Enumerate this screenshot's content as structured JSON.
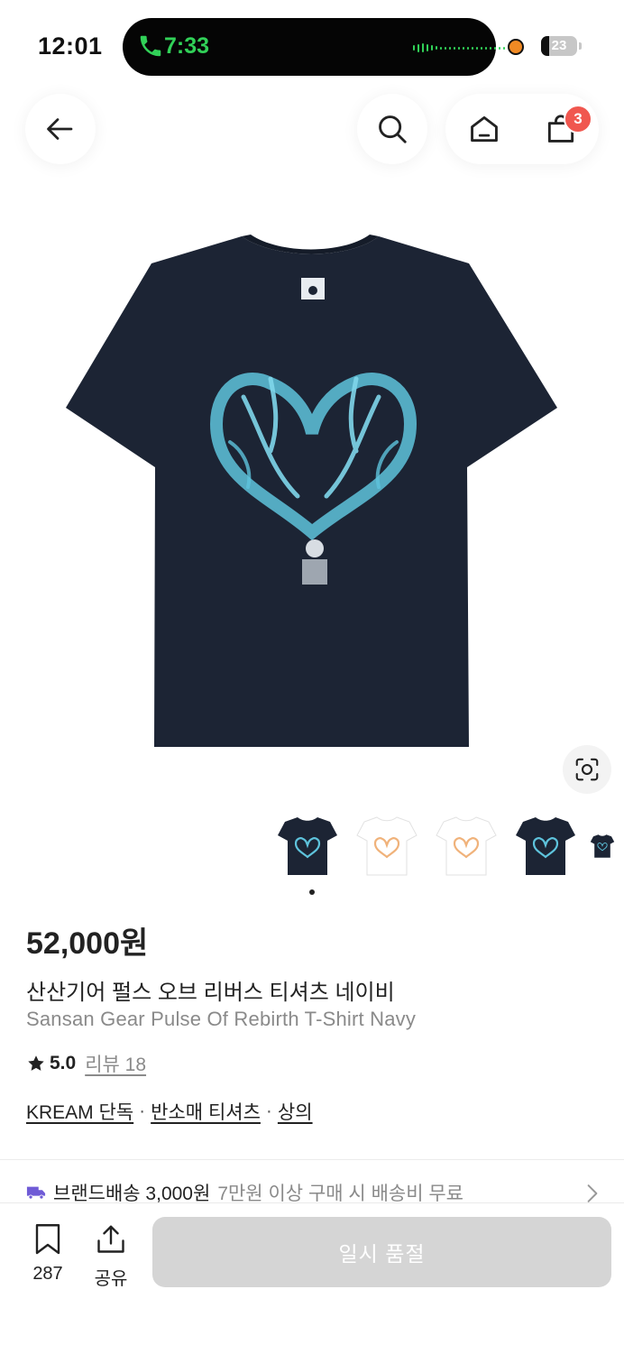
{
  "status_bar": {
    "time": "12:01",
    "call_time": "7:33",
    "battery": "23",
    "battery_level": 0.23
  },
  "nav": {
    "back_icon": "arrow-left-icon",
    "search_icon": "search-icon",
    "home_icon": "home-icon",
    "cart_icon": "shopping-bag-icon",
    "cart_badge": "3"
  },
  "product": {
    "price": "52,000원",
    "name_ko": "산산기어 펄스 오브 리버스 티셔츠 네이비",
    "name_en": "Sansan Gear Pulse Of Rebirth T-Shirt Navy",
    "rating": "5.0",
    "reviews_label": "리뷰 18",
    "categories": [
      "KREAM 단독",
      "반소매 티셔츠",
      "상의"
    ],
    "separator": "·",
    "shirt_color": "#1c2434",
    "print_color": "#5ec3dc",
    "thumbnails": [
      {
        "shirt": "#1c2434",
        "print": "#5ec3dc"
      },
      {
        "shirt": "#ffffff",
        "print": "#f0b27a"
      },
      {
        "shirt": "#ffffff",
        "print": "#f0b27a"
      },
      {
        "shirt": "#1c2434",
        "print": "#5ec3dc"
      },
      {
        "shirt": "#1c2434",
        "print": "#5ec3dc"
      }
    ],
    "active_thumbnail": 1
  },
  "shipping": {
    "icon": "truck-icon",
    "label": "브랜드배송 3,000원",
    "note": "7만원 이상 구매 시 배송비 무료"
  },
  "bottom_bar": {
    "bookmark_count": "287",
    "share_label": "공유",
    "cta_label": "일시 품절"
  },
  "colors": {
    "accent_purple": "#6f5bd6",
    "badge_red": "#f0574f",
    "call_green": "#31d158",
    "disabled_gray": "#d5d5d5"
  }
}
